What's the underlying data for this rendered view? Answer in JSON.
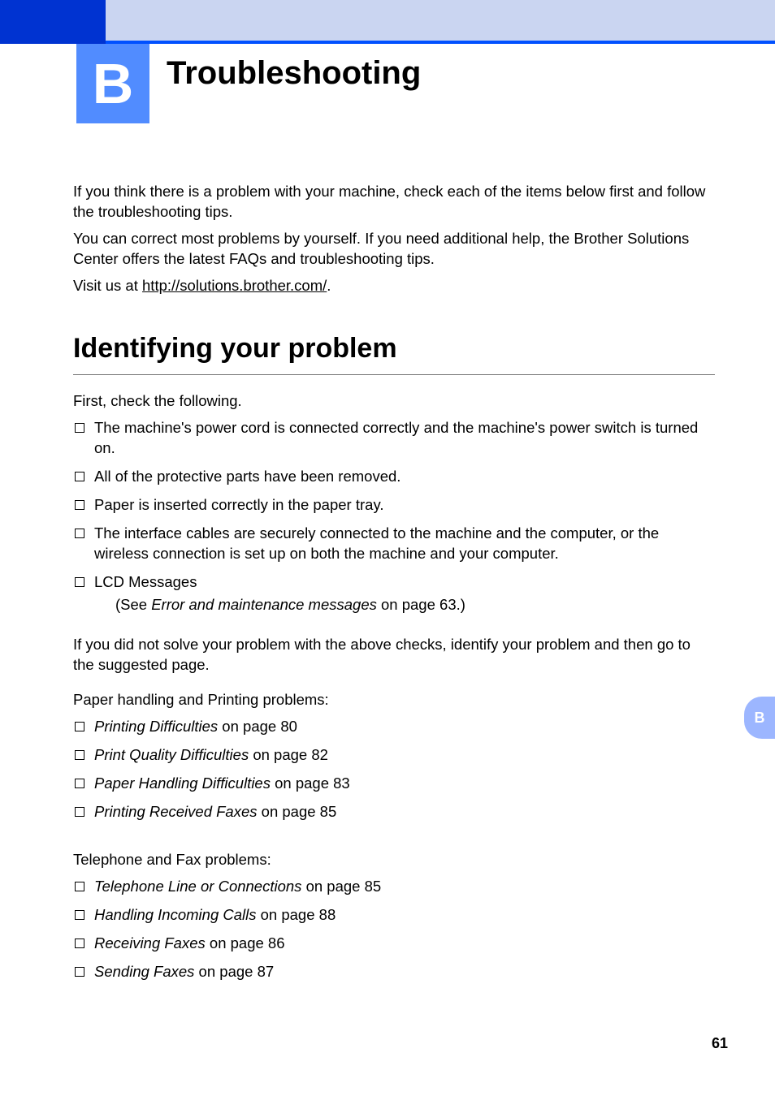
{
  "chapter": {
    "letter": "B",
    "title": "Troubleshooting"
  },
  "intro": {
    "p1": "If you think there is a problem with your machine, check each of the items below first and follow the troubleshooting tips.",
    "p2": "You can correct most problems by yourself. If you need additional help, the Brother Solutions Center offers the latest FAQs and troubleshooting tips.",
    "p3_prefix": "Visit us at ",
    "p3_link": "http://solutions.brother.com/",
    "p3_suffix": "."
  },
  "section": {
    "title": "Identifying your problem",
    "lead": "First, check the following.",
    "checks": [
      "The machine's power cord is connected correctly and the machine's power switch is turned on.",
      "All of the protective parts have been removed.",
      "Paper is inserted correctly in the paper tray.",
      "The interface cables are securely connected to the machine and the computer, or the wireless connection is set up on both the machine and your computer.",
      "LCD Messages"
    ],
    "lcd_note_prefix": "(See ",
    "lcd_note_italic": "Error and maintenance messages",
    "lcd_note_suffix": " on page 63.)",
    "after": "If you did not solve your problem with the above checks, identify your problem and then go to the suggested page."
  },
  "groups": [
    {
      "heading": "Paper handling and Printing problems:",
      "items": [
        {
          "title": "Printing Difficulties",
          "page": "80"
        },
        {
          "title": "Print Quality Difficulties",
          "page": "82"
        },
        {
          "title": "Paper Handling Difficulties",
          "page": "83"
        },
        {
          "title": "Printing Received Faxes",
          "page": "85"
        }
      ]
    },
    {
      "heading": "Telephone and Fax problems:",
      "items": [
        {
          "title": "Telephone Line or Connections",
          "page": "85"
        },
        {
          "title": "Handling Incoming Calls",
          "page": "88"
        },
        {
          "title": "Receiving Faxes",
          "page": "86"
        },
        {
          "title": "Sending Faxes",
          "page": "87"
        }
      ]
    }
  ],
  "sidetab": "B",
  "page_number": "61",
  "on_page_label": " on page "
}
